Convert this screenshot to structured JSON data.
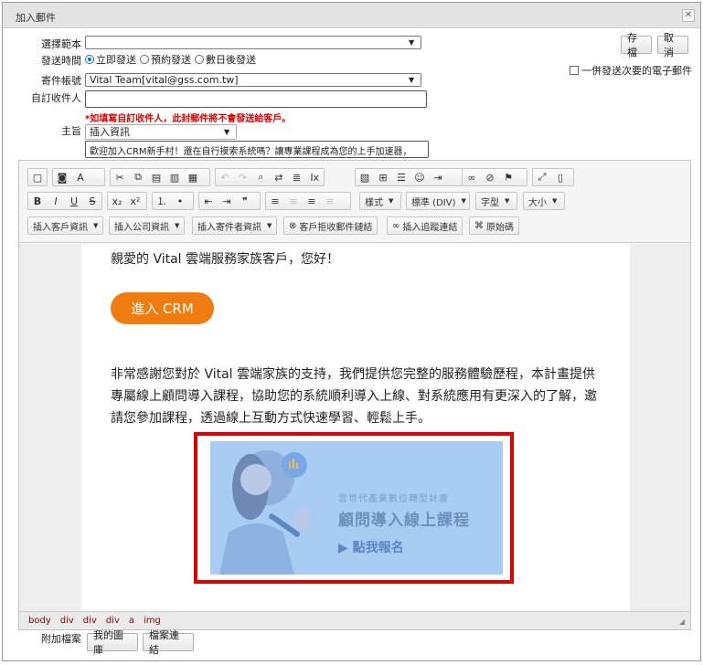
{
  "window": {
    "title": "加入郵件"
  },
  "form": {
    "template_label": "選擇範本",
    "template_value": "",
    "send_time_label": "發送時間",
    "send_options": [
      "立即發送",
      "預約發送",
      "數日後發送"
    ],
    "account_label": "寄件帳號",
    "account_value": "Vital Team[vital@gss.com.tw]",
    "custom_recipient_label": "自訂收件人",
    "custom_recipient_value": "",
    "warning": "*如填寫自訂收件人，此封郵件將不會發送給客戶。",
    "subject_label": "主旨",
    "insert_info_select": "插入資訊",
    "subject_value": "歡迎加入CRM新手村！還在自行摸索系統嗎？讓專業課程成為您的上手加速器，"
  },
  "actions": {
    "save": "存檔",
    "cancel": "取消",
    "send_secondary": "一併發送次要的電子郵件"
  },
  "toolbar": {
    "style_drop": "樣式",
    "format_drop": "標準 (DIV)",
    "font_drop": "字型",
    "size_drop": "大小",
    "insert_customer": "插入客戶資訊",
    "insert_company": "插入公司資訊",
    "insert_sender": "插入寄件者資訊",
    "reject_link": "客戶拒收郵件鏈結",
    "tracking_link": "插入追蹤連結",
    "source": "原始碼"
  },
  "content": {
    "greeting": "親愛的 Vital 雲端服務家族客戶，您好！",
    "cta": "進入 CRM",
    "paragraph": "非常感謝您對於 Vital 雲端家族的支持，我們提供您完整的服務體驗歷程，本計畫提供專屬線上顧問導入課程，協助您的系統順利導入上線、對系統應用有更深入的了解，邀請您參加課程，透過線上互動方式快速學習、輕鬆上手。",
    "banner": {
      "subtitle": "雲世代產業數位轉型計畫",
      "title": "顧問導入線上課程",
      "cta": "▶ 點我報名"
    }
  },
  "breadcrumb": [
    "body",
    "div",
    "div",
    "div",
    "a",
    "img"
  ],
  "attachments": {
    "label": "附加檔案",
    "gallery": "我的圖庫",
    "file_link": "檔案連結"
  },
  "colors": {
    "accent_orange": "#f07c0f",
    "highlight_red": "#e00000",
    "banner_blue": "#a9ccf3"
  }
}
